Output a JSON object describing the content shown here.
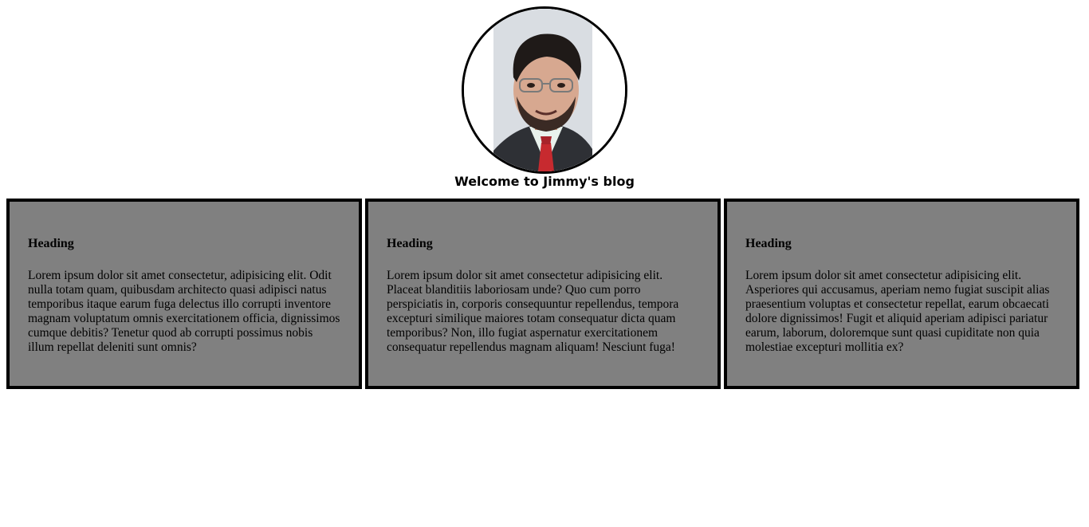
{
  "profile": {
    "avatar_alt": "Profile photo"
  },
  "welcome_text": "Welcome to Jimmy's blog",
  "cards": [
    {
      "heading": "Heading",
      "text": "Lorem ipsum dolor sit amet consectetur, adipisicing elit. Odit nulla totam quam, quibusdam architecto quasi adipisci natus temporibus itaque earum fuga delectus illo corrupti inventore magnam voluptatum omnis exercitationem officia, dignissimos cumque debitis? Tenetur quod ab corrupti possimus nobis illum repellat deleniti sunt omnis?"
    },
    {
      "heading": "Heading",
      "text": "Lorem ipsum dolor sit amet consectetur adipisicing elit. Placeat blanditiis laboriosam unde? Quo cum porro perspiciatis in, corporis consequuntur repellendus, tempora excepturi similique maiores totam consequatur dicta quam temporibus? Non, illo fugiat aspernatur exercitationem consequatur repellendus magnam aliquam! Nesciunt fuga!"
    },
    {
      "heading": "Heading",
      "text": "Lorem ipsum dolor sit amet consectetur adipisicing elit. Asperiores qui accusamus, aperiam nemo fugiat suscipit alias praesentium voluptas et consectetur repellat, earum obcaecati dolore dignissimos! Fugit et aliquid aperiam adipisci pariatur earum, laborum, doloremque sunt quasi cupiditate non quia molestiae excepturi mollitia ex?"
    }
  ],
  "colors": {
    "card_background": "#808080",
    "border": "#000000",
    "page_background": "#ffffff"
  }
}
